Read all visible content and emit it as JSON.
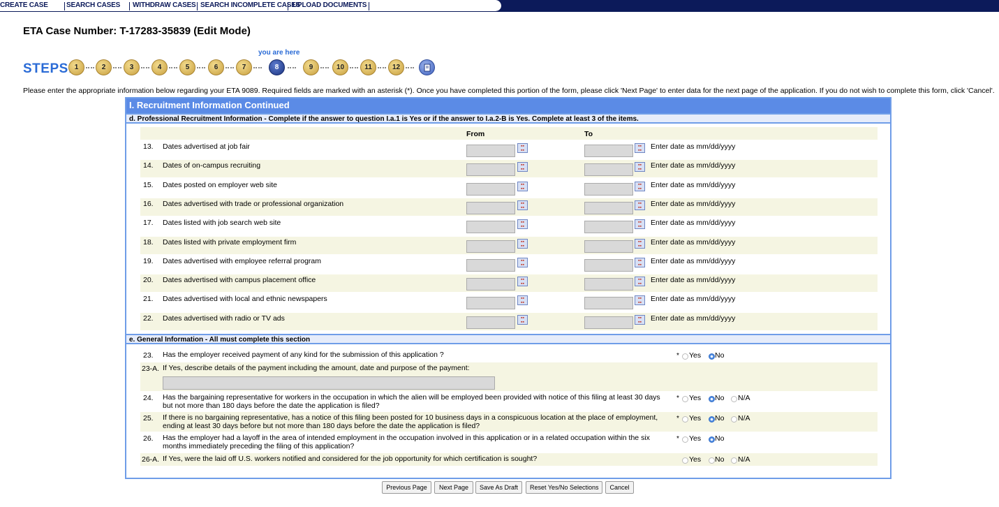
{
  "nav": {
    "items": [
      "CREATE CASE",
      "SEARCH CASES",
      "WITHDRAW CASES",
      "SEARCH INCOMPLETE CASES",
      "UPLOAD DOCUMENTS"
    ]
  },
  "page_title": "ETA Case Number: T-17283-35839  (Edit Mode)",
  "steps": {
    "label": "STEPS:",
    "here_label": "you are here",
    "items": [
      "1",
      "2",
      "3",
      "4",
      "5",
      "6",
      "7",
      "8",
      "9",
      "10",
      "11",
      "12"
    ],
    "current": "8"
  },
  "instructions": "Please enter the appropriate information below regarding your ETA 9089. Required fields are marked with an asterisk (*). Once you have completed this portion of the form, please click 'Next Page' to enter data for the next page of the application. If you do not wish to complete this form, click 'Cancel'.",
  "section": {
    "title": "I. Recruitment Information Continued",
    "d_header": "d. Professional Recruitment Information - Complete if the answer to question I.a.1 is Yes or if the answer to I.a.2-B is Yes. Complete at least 3 of the items.",
    "col_from": "From",
    "col_to": "To",
    "date_hint": "Enter date as mm/dd/yyyy",
    "rows": [
      {
        "num": "13.",
        "label": "Dates advertised at job fair"
      },
      {
        "num": "14.",
        "label": "Dates of on-campus recruiting"
      },
      {
        "num": "15.",
        "label": "Dates posted on employer web site"
      },
      {
        "num": "16.",
        "label": "Dates advertised with trade or professional organization"
      },
      {
        "num": "17.",
        "label": "Dates listed with job search web site"
      },
      {
        "num": "18.",
        "label": "Dates listed with private employment firm"
      },
      {
        "num": "19.",
        "label": "Dates advertised with employee referral program"
      },
      {
        "num": "20.",
        "label": "Dates advertised with campus placement office"
      },
      {
        "num": "21.",
        "label": "Dates advertised with local and ethnic newspapers"
      },
      {
        "num": "22.",
        "label": "Dates advertised with radio or TV ads"
      }
    ],
    "e_header": "e. General Information - All must complete this section",
    "questions": [
      {
        "num": "23.",
        "text": "Has the employer received payment of any kind for the submission of this application ?",
        "asterisk": "*",
        "options": [
          "Yes",
          "No"
        ],
        "selected": "No"
      },
      {
        "num": "23-A.",
        "text": "If Yes, describe details of the payment including the amount, date and purpose of the payment:",
        "value": ""
      },
      {
        "num": "24.",
        "text": "Has the bargaining representative for workers in the occupation in which the alien will be employed been provided with notice of this filing at least 30 days but not more than 180 days before the date the application is filed?",
        "asterisk": "*",
        "options": [
          "Yes",
          "No",
          "N/A"
        ],
        "selected": "No"
      },
      {
        "num": "25.",
        "text": "If there is no bargaining representative, has a notice of this filing been posted for 10 business days in a conspicuous location at the place of employment, ending at least 30 days before but not more than 180 days before the date the application is filed?",
        "asterisk": "*",
        "options": [
          "Yes",
          "No",
          "N/A"
        ],
        "selected": "No"
      },
      {
        "num": "26.",
        "text": "Has the employer had a layoff in the area of intended employment in the occupation involved in this application or in a related occupation within the six months immediately preceding the filing of this application?",
        "asterisk": "*",
        "options": [
          "Yes",
          "No"
        ],
        "selected": "No"
      },
      {
        "num": "26-A.",
        "text": "If Yes, were the laid off U.S. workers notified and considered for the job opportunity for which certification is sought?",
        "options": [
          "Yes",
          "No",
          "N/A"
        ],
        "selected": ""
      }
    ]
  },
  "buttons": {
    "previous": "Previous Page",
    "next": "Next Page",
    "draft": "Save As Draft",
    "reset": "Reset Yes/No Selections",
    "cancel": "Cancel"
  },
  "colors": {
    "nav_bg": "#0c1a5a",
    "section_header": "#5b8be6",
    "row_stripe": "#f5f5e2",
    "steps_text": "#2a6bd6"
  }
}
